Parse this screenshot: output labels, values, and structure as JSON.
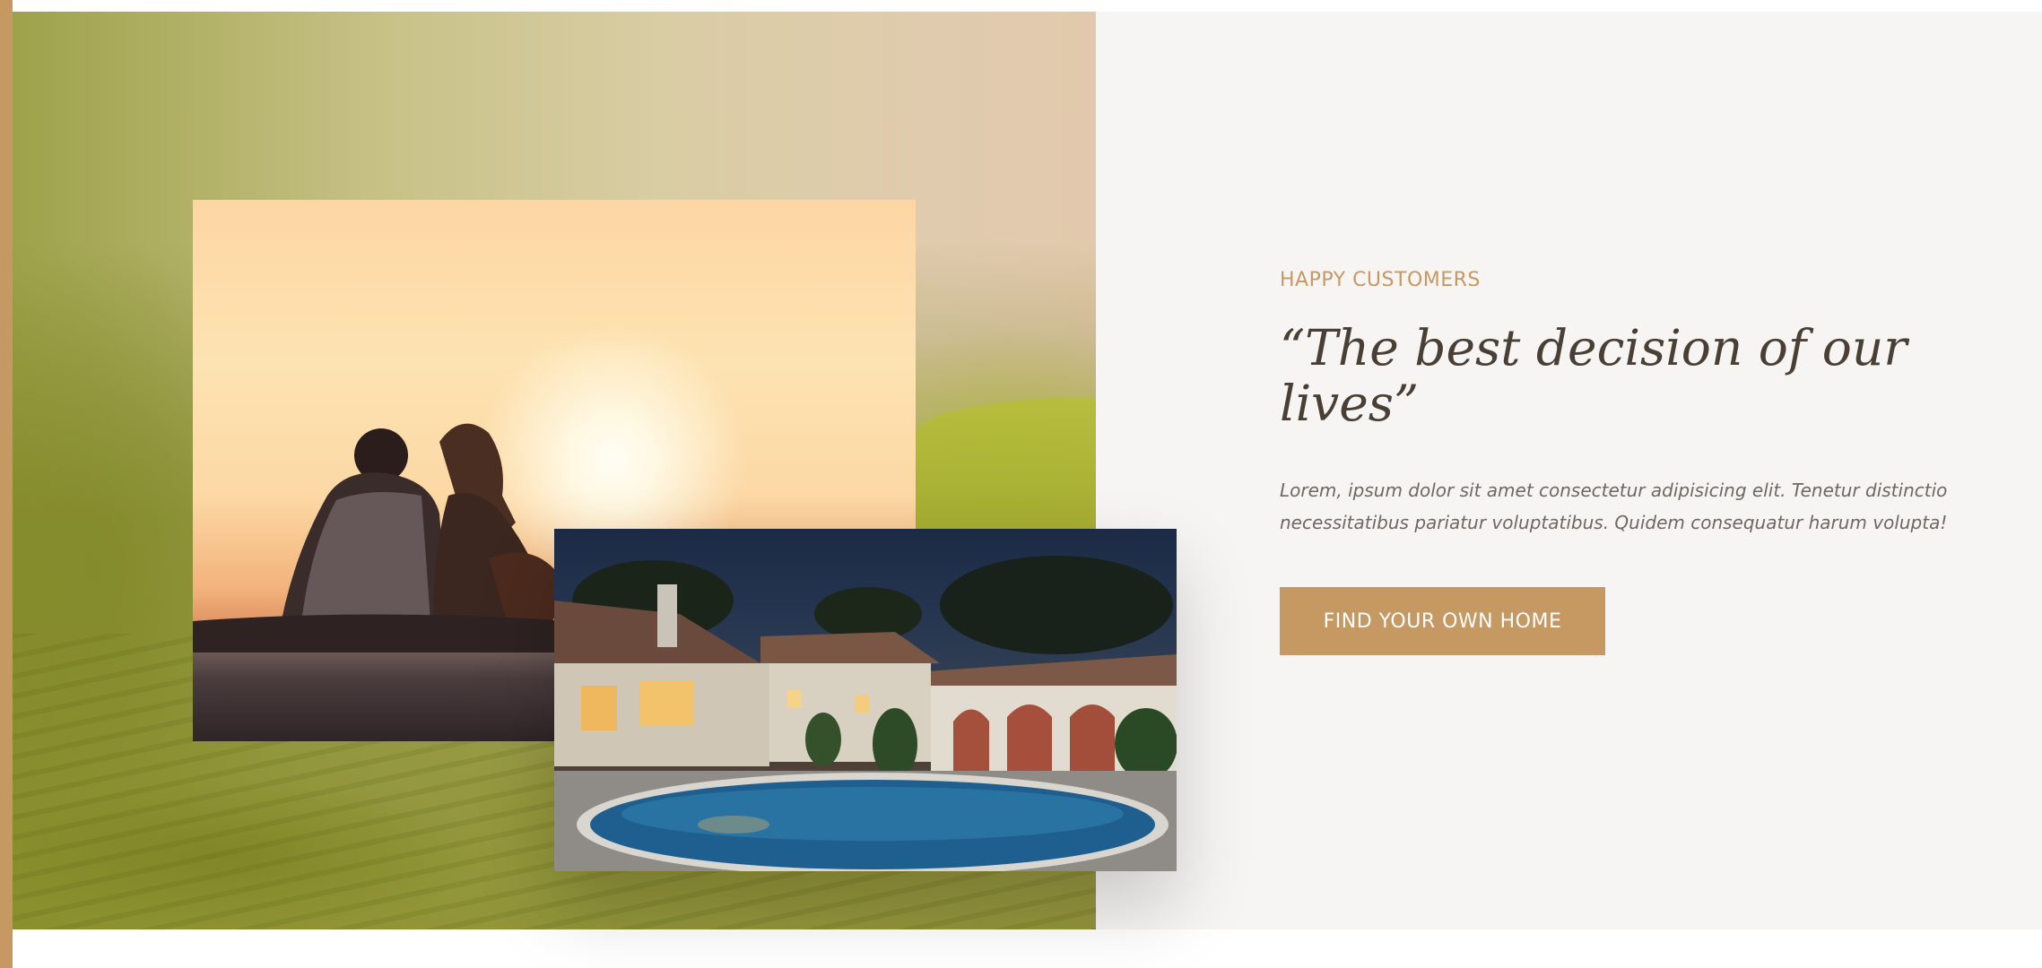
{
  "section": {
    "eyebrow": "HAPPY CUSTOMERS",
    "quote": "“The best decision of our lives”",
    "body": "Lorem, ipsum dolor sit amet consectetur adipisicing elit. Tenetur distinctio necessitatibus pariatur voluptatibus. Quidem consequatur harum volupta!",
    "cta_label": "FIND YOUR OWN HOME"
  },
  "colors": {
    "accent": "#c69963",
    "heading": "#4a3f35",
    "body_text": "#6f6862",
    "section_bg": "#f7f5f3"
  }
}
